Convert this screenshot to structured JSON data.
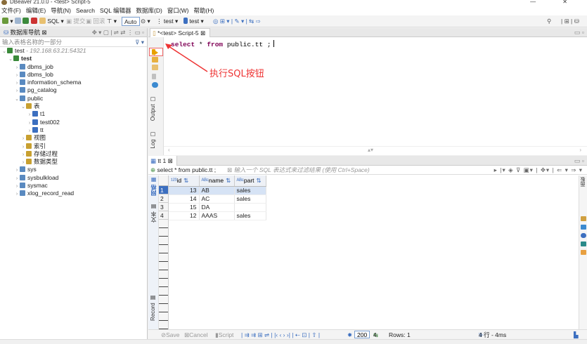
{
  "app": {
    "title": "DBeaver 21.0.0 - <test> Script-5"
  },
  "menu": [
    "文件(F)",
    "编辑(E)",
    "导航(N)",
    "Search",
    "SQL 编辑器",
    "数据库(D)",
    "窗口(W)",
    "帮助(H)"
  ],
  "toolbar": {
    "sql_label": "SQL",
    "commit_label": "提交",
    "rollback_label": "回滚",
    "auto_label": "Auto",
    "db_label": "test",
    "schema_label": "test"
  },
  "navigator": {
    "title": "数据库导航",
    "filter_placeholder": "输入表格名称的一部分",
    "connection": {
      "name": "test",
      "ip": "- 192.168.63.21:54321"
    },
    "tree": [
      {
        "label": "test",
        "depth": 1,
        "bold": true,
        "arrow": "⌄"
      },
      {
        "label": "dbms_job",
        "depth": 2,
        "arrow": "›"
      },
      {
        "label": "dbms_lob",
        "depth": 2,
        "arrow": "›"
      },
      {
        "label": "information_schema",
        "depth": 2,
        "arrow": "›"
      },
      {
        "label": "pg_catalog",
        "depth": 2,
        "arrow": "›"
      },
      {
        "label": "public",
        "depth": 2,
        "arrow": "⌄"
      },
      {
        "label": "表",
        "depth": 3,
        "arrow": "⌄"
      },
      {
        "label": "t1",
        "depth": 4,
        "arrow": "›"
      },
      {
        "label": "test002",
        "depth": 4,
        "arrow": "›"
      },
      {
        "label": "tt",
        "depth": 4,
        "arrow": "›"
      },
      {
        "label": "视图",
        "depth": 3,
        "arrow": "›"
      },
      {
        "label": "索引",
        "depth": 3,
        "arrow": "›"
      },
      {
        "label": "存储过程",
        "depth": 3,
        "arrow": "›"
      },
      {
        "label": "数据类型",
        "depth": 3,
        "arrow": "›"
      },
      {
        "label": "sys",
        "depth": 2,
        "arrow": "›"
      },
      {
        "label": "sysbulkload",
        "depth": 2,
        "arrow": "›"
      },
      {
        "label": "sysmac",
        "depth": 2,
        "arrow": "›"
      },
      {
        "label": "xlog_record_read",
        "depth": 2,
        "arrow": "›"
      }
    ]
  },
  "editor": {
    "tab_title": "*<test> Script-5",
    "code_kw1": "select",
    "code_mid": " * ",
    "code_kw2": "from",
    "code_rest": " public.tt ;",
    "annotation": "执行SQL按钮",
    "side_tabs": {
      "output": "Output",
      "log": "Log"
    }
  },
  "results": {
    "tab_title": "tt 1",
    "query": "select * from public.tt",
    "filter_placeholder": "输入一个 SQL 表达式来过滤结果 (使用 Ctrl+Space)",
    "side_tabs": {
      "grid": "网格",
      "text": "文本",
      "record": "Record"
    },
    "columns": [
      "id",
      "name",
      "part"
    ],
    "rows": [
      {
        "n": "1",
        "id": "13",
        "name": "AB",
        "part": "sales"
      },
      {
        "n": "2",
        "id": "14",
        "name": "AC",
        "part": "sales"
      },
      {
        "n": "3",
        "id": "15",
        "name": "DA",
        "part": ""
      },
      {
        "n": "4",
        "id": "12",
        "name": "AAAS",
        "part": "sales"
      }
    ],
    "right_tab": "面板"
  },
  "status": {
    "save": "Save",
    "cancel": "Cancel",
    "script": "Script",
    "fetch_size": "200",
    "row_count": "4",
    "rows_label": "Rows: 1",
    "summary": "4 行 - 4ms"
  }
}
